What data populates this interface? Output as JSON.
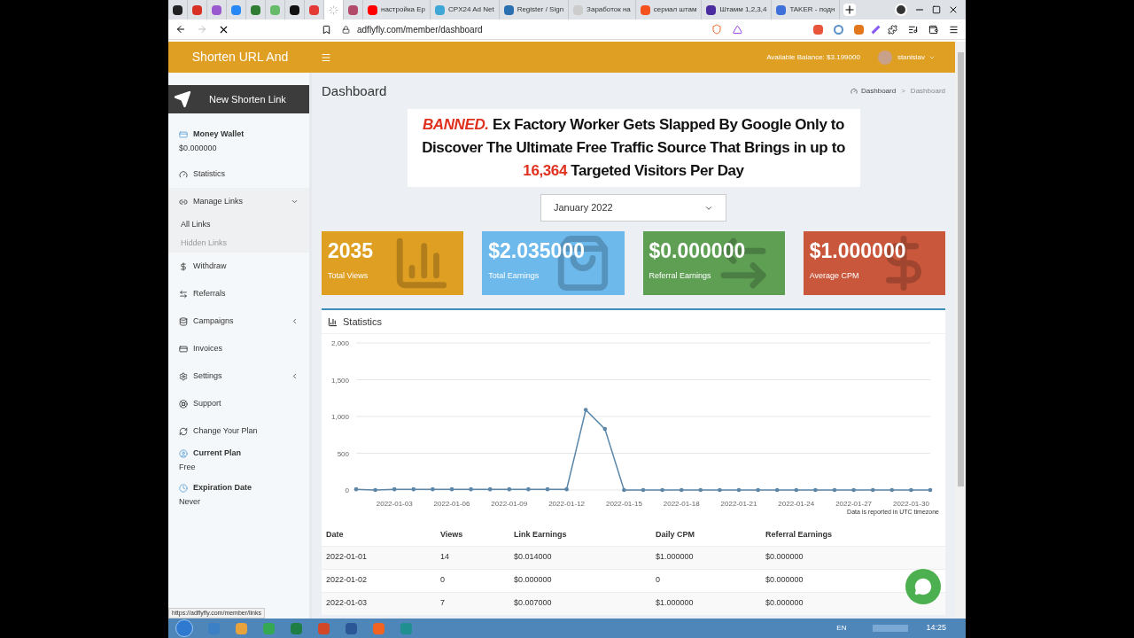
{
  "browser": {
    "tabs": [
      {
        "color": "#222222",
        "selected": false
      },
      {
        "color": "#d93025",
        "selected": false
      },
      {
        "color": "#9b59d0",
        "selected": false
      },
      {
        "color": "#2787f5",
        "selected": false
      },
      {
        "color": "#2e7d32",
        "selected": false
      },
      {
        "color": "#66bb6a",
        "selected": false
      },
      {
        "color": "#111111",
        "selected": false
      },
      {
        "color": "#e53935",
        "selected": false
      },
      {
        "color": "#bbbbbb",
        "selected": true
      },
      {
        "color": "#b24b6a",
        "selected": false
      },
      {
        "title": "настройка Ep",
        "color": "#ff0000",
        "selected": false
      },
      {
        "title": "CPX24 Ad Net",
        "color": "#3fa7d6",
        "selected": false
      },
      {
        "title": "Register / Sign",
        "color": "#2a6fb0",
        "selected": false
      },
      {
        "title": "Заработок на",
        "color": "#cccccc",
        "selected": false
      },
      {
        "title": "сериал штам",
        "color": "#f4511e",
        "selected": false
      },
      {
        "title": "Штамм 1,2,3,4",
        "color": "#4b2ca0",
        "selected": false
      },
      {
        "title": "TAKER - подн",
        "color": "#3f6fd8",
        "selected": false
      }
    ],
    "url": "adflyfly.com/member/dashboard",
    "status_url": "https://adflyfly.com/member/links"
  },
  "header": {
    "brand": "Shorten URL And",
    "balance": "Available Balance: $3.199000",
    "user": "stanislav"
  },
  "sidebar": {
    "new_button": "New Shorten Link",
    "items": [
      {
        "kind": "info",
        "label": "Money Wallet",
        "value": "$0.000000"
      },
      {
        "kind": "link",
        "label": "Statistics"
      },
      {
        "kind": "group",
        "label": "Manage Links",
        "expanded": true,
        "children": [
          {
            "label": "All Links",
            "selected": true
          },
          {
            "label": "Hidden Links",
            "selected": false
          }
        ]
      },
      {
        "kind": "link",
        "label": "Withdraw"
      },
      {
        "kind": "link",
        "label": "Referrals"
      },
      {
        "kind": "group",
        "label": "Campaigns",
        "expanded": false
      },
      {
        "kind": "link",
        "label": "Invoices"
      },
      {
        "kind": "group",
        "label": "Settings",
        "expanded": false
      },
      {
        "kind": "link",
        "label": "Support"
      },
      {
        "kind": "link",
        "label": "Change Your Plan"
      },
      {
        "kind": "info",
        "label": "Current Plan",
        "value": "Free"
      },
      {
        "kind": "info",
        "label": "Expiration Date",
        "value": "Never"
      }
    ]
  },
  "page": {
    "title": "Dashboard",
    "breadcrumb": [
      "Dashboard",
      "Dashboard"
    ],
    "breadcrumb_separator": ">",
    "banner": {
      "highlight": "BANNED.",
      "text": "Ex Factory Worker Gets Slapped By Google Only to Discover The Ultimate Free Traffic Source That Brings in up to",
      "number": "16,364",
      "tail": "Targeted Visitors Per Day"
    },
    "month": "January 2022",
    "cards": [
      {
        "value": "2035",
        "label": "Total Views",
        "color": "#df9f22"
      },
      {
        "value": "$2.035000",
        "label": "Total Earnings",
        "color": "#6db9ec"
      },
      {
        "value": "$0.000000",
        "label": "Referral Earnings",
        "color": "#5f9f54"
      },
      {
        "value": "$1.000000",
        "label": "Average CPM",
        "color": "#c9573b"
      }
    ],
    "statistics": {
      "title": "Statistics",
      "note": "Data is reported in UTC timezone",
      "chart_data": {
        "type": "line",
        "grid": true,
        "categories": [
          null,
          null,
          "2022-01-03",
          null,
          null,
          "2022-01-06",
          null,
          null,
          "2022-01-09",
          null,
          null,
          "2022-01-12",
          null,
          null,
          "2022-01-15",
          null,
          null,
          "2022-01-18",
          null,
          null,
          "2022-01-21",
          null,
          null,
          "2022-01-24",
          null,
          null,
          "2022-01-27",
          null,
          null,
          "2022-01-30",
          null
        ],
        "series": [
          {
            "color": "#5b86a8",
            "values": [
              10,
              0,
              10,
              10,
              10,
              10,
              10,
              10,
              10,
              10,
              10,
              10,
              1090,
              830,
              0,
              0,
              0,
              0,
              0,
              0,
              0,
              0,
              0,
              0,
              0,
              0,
              0,
              0,
              0,
              0,
              0
            ]
          }
        ],
        "ylim": [
          0,
          2000
        ],
        "yticks": [
          {
            "value": 0,
            "label": "0"
          },
          {
            "value": 500,
            "label": "500"
          },
          {
            "value": 1000,
            "label": "1,000"
          },
          {
            "value": 1500,
            "label": "1,500"
          },
          {
            "value": 2000,
            "label": "2,000"
          }
        ]
      }
    },
    "table": {
      "columns": [
        "Date",
        "Views",
        "Link Earnings",
        "Daily CPM",
        "Referral Earnings"
      ],
      "rows": [
        [
          "2022-01-01",
          "14",
          "$0.014000",
          "$1.000000",
          "$0.000000"
        ],
        [
          "2022-01-02",
          "0",
          "$0.000000",
          "0",
          "$0.000000"
        ],
        [
          "2022-01-03",
          "7",
          "$0.007000",
          "$1.000000",
          "$0.000000"
        ]
      ]
    }
  },
  "taskbar": {
    "language": "EN",
    "time": "14:25"
  }
}
